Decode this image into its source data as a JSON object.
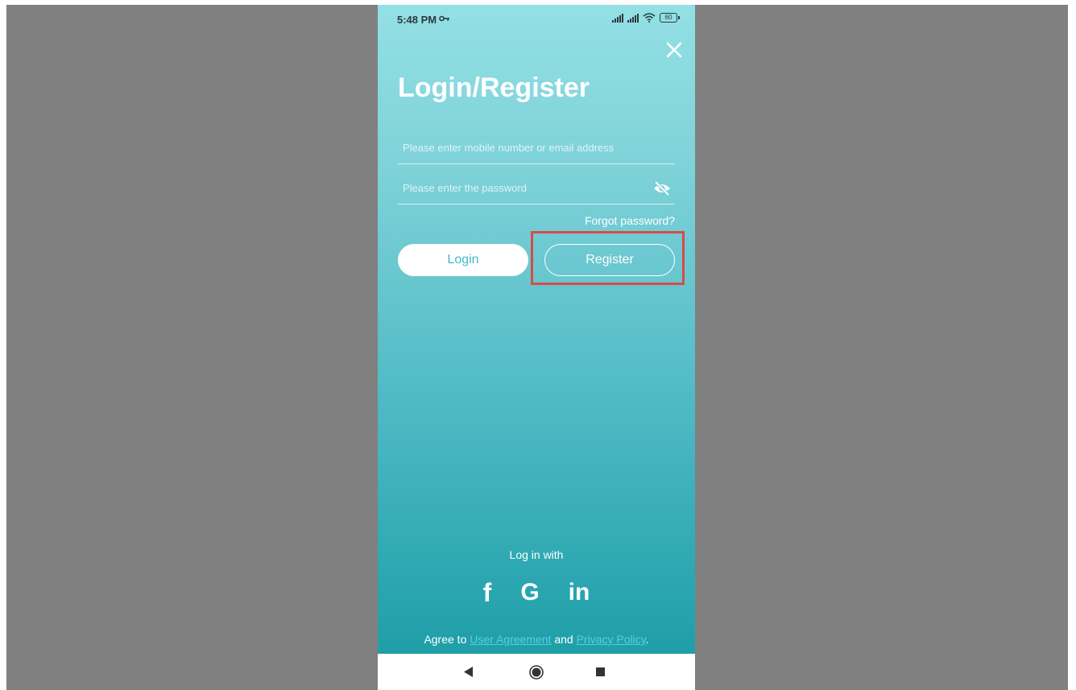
{
  "status_bar": {
    "time": "5:48 PM",
    "battery": "60",
    "key_icon": "vpn-key-icon",
    "signal_icons": [
      "signal-icon",
      "signal-icon",
      "wifi-icon"
    ]
  },
  "header": {
    "title": "Login/Register",
    "close_icon": "close-icon"
  },
  "form": {
    "email_placeholder": "Please enter mobile number or email address",
    "email_value": "",
    "password_placeholder": "Please enter the password",
    "password_value": "",
    "password_toggle_icon": "eye-off-icon",
    "forgot_label": "Forgot password?"
  },
  "actions": {
    "login_label": "Login",
    "register_label": "Register"
  },
  "social": {
    "heading": "Log in with",
    "providers": [
      {
        "name": "facebook",
        "glyph": "f",
        "icon": "facebook-icon"
      },
      {
        "name": "google",
        "glyph": "G",
        "icon": "google-icon"
      },
      {
        "name": "linkedin",
        "glyph": "in",
        "icon": "linkedin-icon"
      }
    ]
  },
  "agreement": {
    "prefix": "Agree to ",
    "user_agreement": "User Agreement",
    "middle": " and ",
    "privacy_policy": "Privacy Policy",
    "suffix": "."
  },
  "navbar": {
    "back_icon": "back-triangle-icon",
    "home_icon": "home-circle-icon",
    "recents_icon": "recents-square-icon"
  },
  "colors": {
    "gradient_top": "#93e0e5",
    "gradient_bottom": "#1a9aa4",
    "highlight": "#d94a4a",
    "link": "#56cfe0",
    "backdrop": "#808080"
  }
}
